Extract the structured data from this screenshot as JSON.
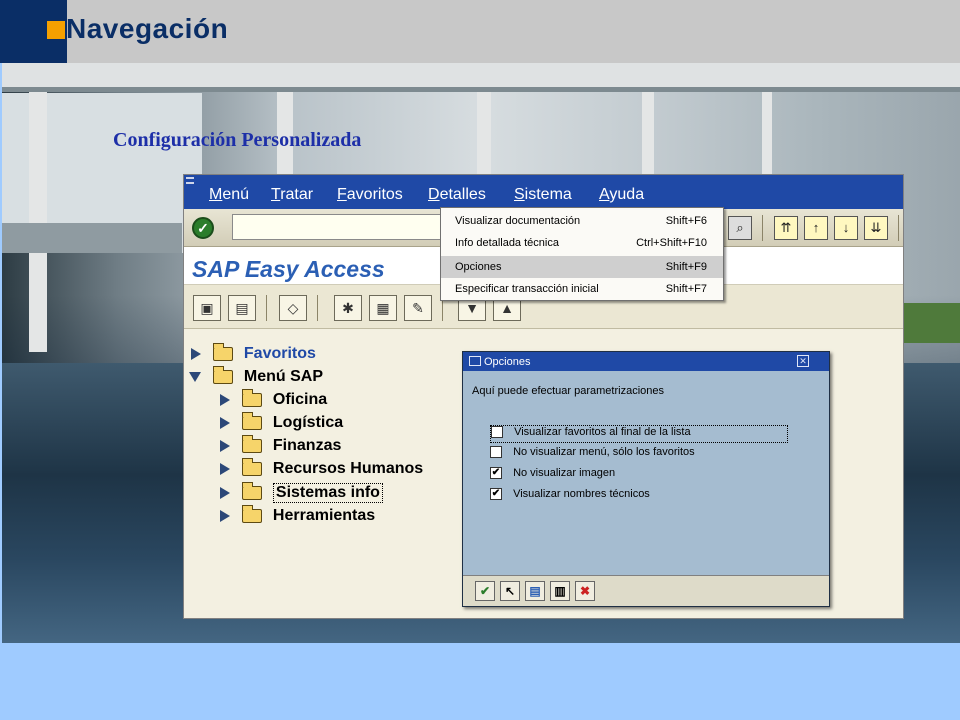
{
  "slide": {
    "title": "Navegación",
    "subtitle": "Configuración Personalizada"
  },
  "sap": {
    "menubar": [
      {
        "label": "Menú",
        "underline_char": "M"
      },
      {
        "label": "Tratar",
        "underline_char": "T"
      },
      {
        "label": "Favoritos",
        "underline_char": "F"
      },
      {
        "label": "Detalles",
        "underline_char": "D"
      },
      {
        "label": "Sistema",
        "underline_char": "S"
      },
      {
        "label": "Ayuda",
        "underline_char": "A"
      }
    ],
    "screen_title": "SAP Easy Access",
    "tree": [
      {
        "label": "Favoritos",
        "expanded": false,
        "level": 0
      },
      {
        "label": "Menú SAP",
        "expanded": true,
        "level": 0
      },
      {
        "label": "Oficina",
        "expanded": false,
        "level": 1
      },
      {
        "label": "Logística",
        "expanded": false,
        "level": 1
      },
      {
        "label": "Finanzas",
        "expanded": false,
        "level": 1
      },
      {
        "label": "Recursos Humanos",
        "expanded": false,
        "level": 1
      },
      {
        "label": "Sistemas info",
        "expanded": false,
        "level": 1,
        "selected": true
      },
      {
        "label": "Herramientas",
        "expanded": false,
        "level": 1
      }
    ]
  },
  "dropdown": {
    "items": [
      {
        "label": "Visualizar documentación",
        "shortcut": "Shift+F6"
      },
      {
        "label": "Info detallada técnica",
        "shortcut": "Ctrl+Shift+F10"
      },
      {
        "label": "Opciones",
        "shortcut": "Shift+F9",
        "highlighted": true
      },
      {
        "label": "Especificar transacción inicial",
        "shortcut": "Shift+F7"
      }
    ]
  },
  "dialog": {
    "title": "Opciones",
    "intro": "Aquí puede efectuar parametrizaciones",
    "options": [
      {
        "label": "Visualizar favoritos al final de la lista",
        "checked": false,
        "focused": true
      },
      {
        "label": "No visualizar menú, sólo los favoritos",
        "checked": false
      },
      {
        "label": "No visualizar imagen",
        "checked": true
      },
      {
        "label": "Visualizar nombres técnicos",
        "checked": true
      }
    ]
  },
  "colors": {
    "header_navy": "#0a2e66",
    "header_accent": "#f5a000",
    "sap_blue": "#1f49a6",
    "dialog_bg": "#a5bcd0",
    "subtitle_blue": "#1d2fa8"
  }
}
